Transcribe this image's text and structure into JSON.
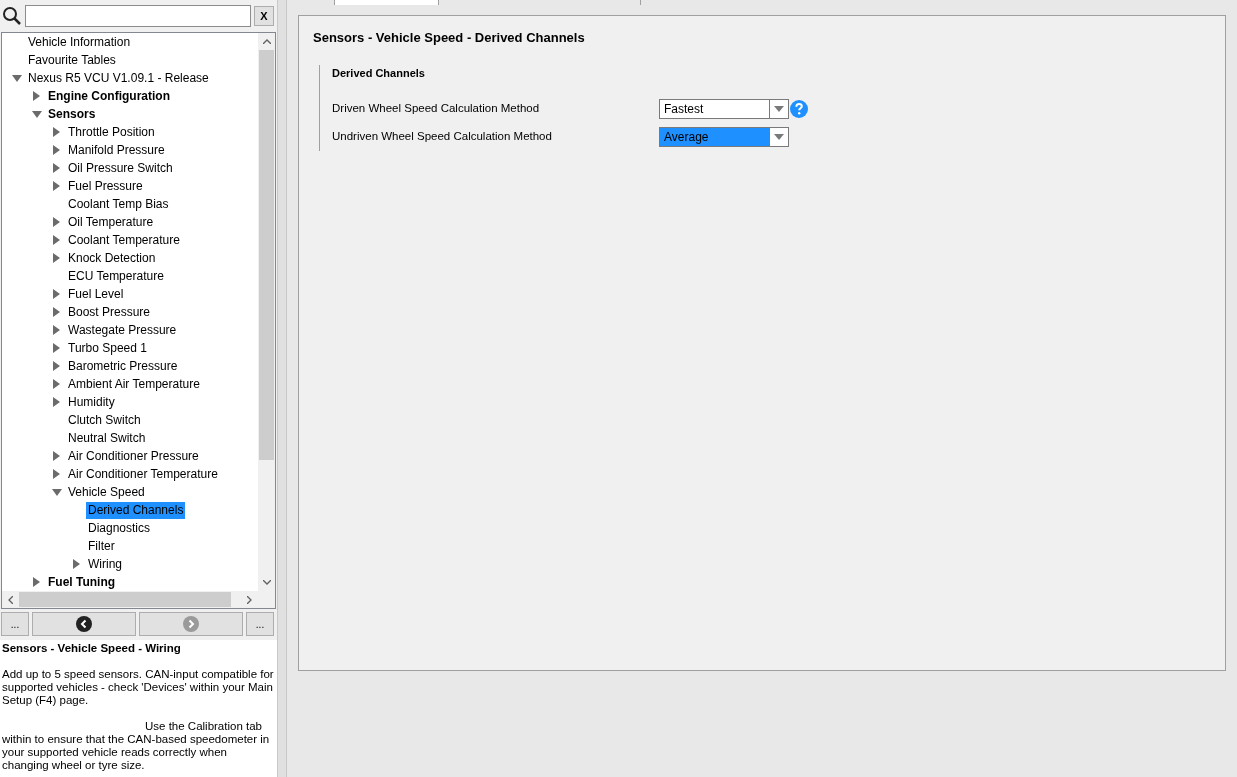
{
  "search": {
    "clear_label": "X"
  },
  "tree": [
    {
      "label": "Vehicle Information",
      "selected": false
    },
    {
      "label": "Favourite Tables",
      "selected": false
    },
    {
      "label": "Nexus R5 VCU V1.09.1 - Release",
      "selected": false,
      "expanded": true,
      "children": [
        {
          "label": "Engine Configuration",
          "selected": false,
          "expanded": false
        },
        {
          "label": "Sensors",
          "selected": false,
          "expanded": true,
          "children": [
            {
              "label": "Throttle Position",
              "selected": false,
              "expanded": false
            },
            {
              "label": "Manifold Pressure",
              "selected": false,
              "expanded": false
            },
            {
              "label": "Oil Pressure Switch",
              "selected": false,
              "expanded": false
            },
            {
              "label": "Fuel Pressure",
              "selected": false,
              "expanded": false
            },
            {
              "label": "Coolant Temp Bias",
              "selected": false
            },
            {
              "label": "Oil Temperature",
              "selected": false,
              "expanded": false
            },
            {
              "label": "Coolant Temperature",
              "selected": false,
              "expanded": false
            },
            {
              "label": "Knock Detection",
              "selected": false,
              "expanded": false
            },
            {
              "label": "ECU Temperature",
              "selected": false
            },
            {
              "label": "Fuel Level",
              "selected": false,
              "expanded": false
            },
            {
              "label": "Boost Pressure",
              "selected": false,
              "expanded": false
            },
            {
              "label": "Wastegate Pressure",
              "selected": false,
              "expanded": false
            },
            {
              "label": "Turbo Speed 1",
              "selected": false,
              "expanded": false
            },
            {
              "label": "Barometric Pressure",
              "selected": false,
              "expanded": false
            },
            {
              "label": "Ambient Air Temperature",
              "selected": false,
              "expanded": false
            },
            {
              "label": "Humidity",
              "selected": false,
              "expanded": false
            },
            {
              "label": "Clutch Switch",
              "selected": false
            },
            {
              "label": "Neutral Switch",
              "selected": false
            },
            {
              "label": "Air Conditioner Pressure",
              "selected": false,
              "expanded": false
            },
            {
              "label": "Air Conditioner Temperature",
              "selected": false,
              "expanded": false
            },
            {
              "label": "Vehicle Speed",
              "selected": false,
              "expanded": true,
              "children": [
                {
                  "label": "Derived Channels",
                  "selected": true
                },
                {
                  "label": "Diagnostics",
                  "selected": false
                },
                {
                  "label": "Filter",
                  "selected": false
                },
                {
                  "label": "Wiring",
                  "selected": false,
                  "expanded": false
                }
              ]
            }
          ]
        },
        {
          "label": "Fuel Tuning",
          "selected": false,
          "expanded": false
        }
      ]
    }
  ],
  "nav": {
    "left_more": "...",
    "back": {
      "disabled": false
    },
    "forward": {
      "disabled": true
    },
    "right_more": "..."
  },
  "help": {
    "title": "Sensors - Vehicle Speed - Wiring",
    "paragraphs": [
      "Add up to 5 speed sensors. CAN-input compatible for supported vehicles - check 'Devices' within your Main Setup (F4) page.",
      "Use the Calibration tab within to ensure that the CAN-based speedometer in your supported vehicle reads correctly when changing wheel or tyre size."
    ]
  },
  "page": {
    "title": "Sensors - Vehicle Speed - Derived Channels",
    "group": "Derived Channels",
    "fields": [
      {
        "label": "Driven Wheel Speed Calculation Method",
        "value": "Fastest",
        "selected": false,
        "help": true
      },
      {
        "label": "Undriven Wheel Speed Calculation Method",
        "value": "Average",
        "selected": true,
        "help": false
      }
    ]
  }
}
